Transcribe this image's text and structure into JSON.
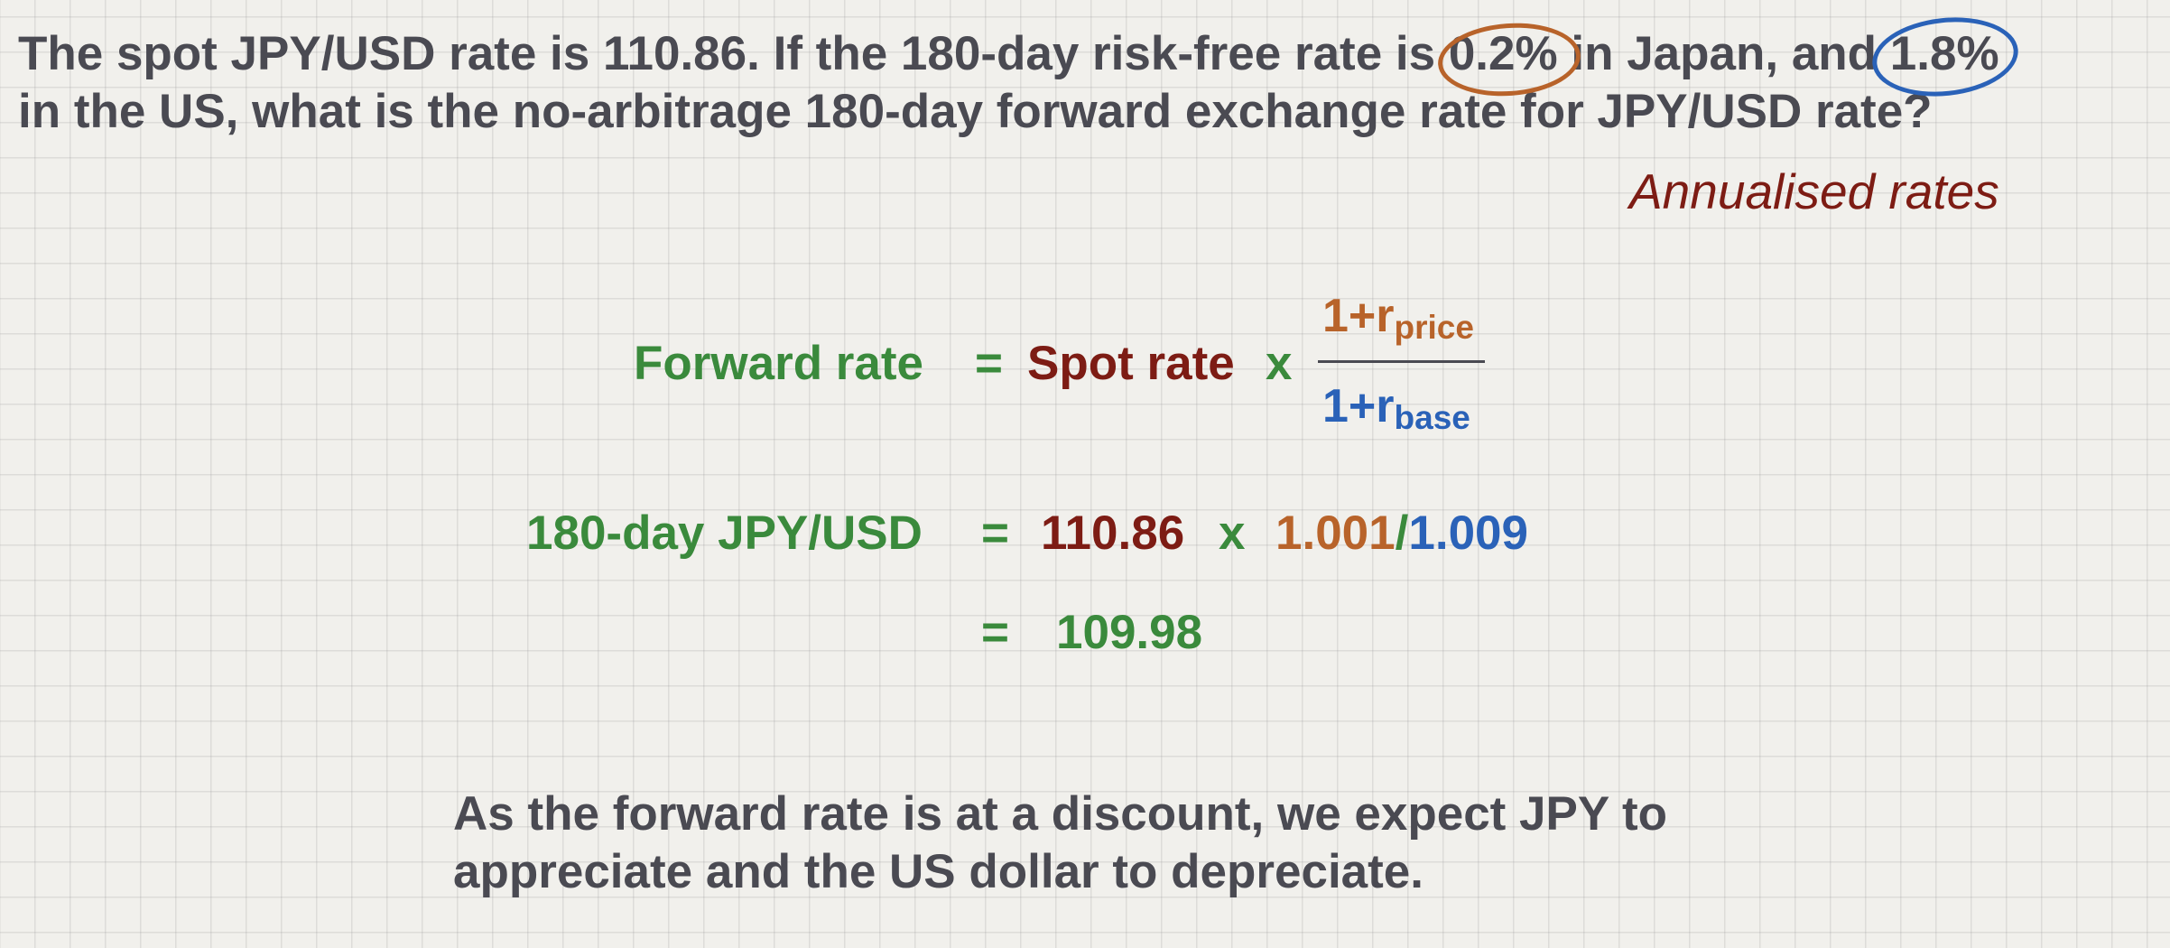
{
  "question": {
    "line1_a": "The spot JPY/USD rate is 110.86.  If the 180-day risk-free rate is ",
    "rate_japan": "0.2%",
    "line1_b": " in Japan, and ",
    "rate_us": "1.8%",
    "line2": "in the US, what is the no-arbitrage 180-day forward exchange rate for JPY/USD rate?"
  },
  "note": "Annualised rates",
  "formula": {
    "lhs": "Forward rate",
    "equals": "=",
    "spot": "Spot rate",
    "times": "x",
    "numerator_main": "1+r",
    "numerator_sub": "price",
    "denominator_main": "1+r",
    "denominator_sub": "base"
  },
  "calculation": {
    "lhs": "180-day JPY/USD",
    "equals": "=",
    "spot_value": "110.86",
    "times": "x",
    "price_factor": "1.001",
    "slash": "/",
    "base_factor": "1.009"
  },
  "result": {
    "equals": "=",
    "value": "109.98"
  },
  "conclusion": {
    "line1": "As the forward rate is at a discount, we expect JPY to",
    "line2": "appreciate and the US dollar to depreciate."
  },
  "colors": {
    "text": "#4a4a52",
    "green": "#3a8a3c",
    "dark_red": "#7d1c14",
    "orange": "#b8632a",
    "blue": "#2a62b8"
  }
}
